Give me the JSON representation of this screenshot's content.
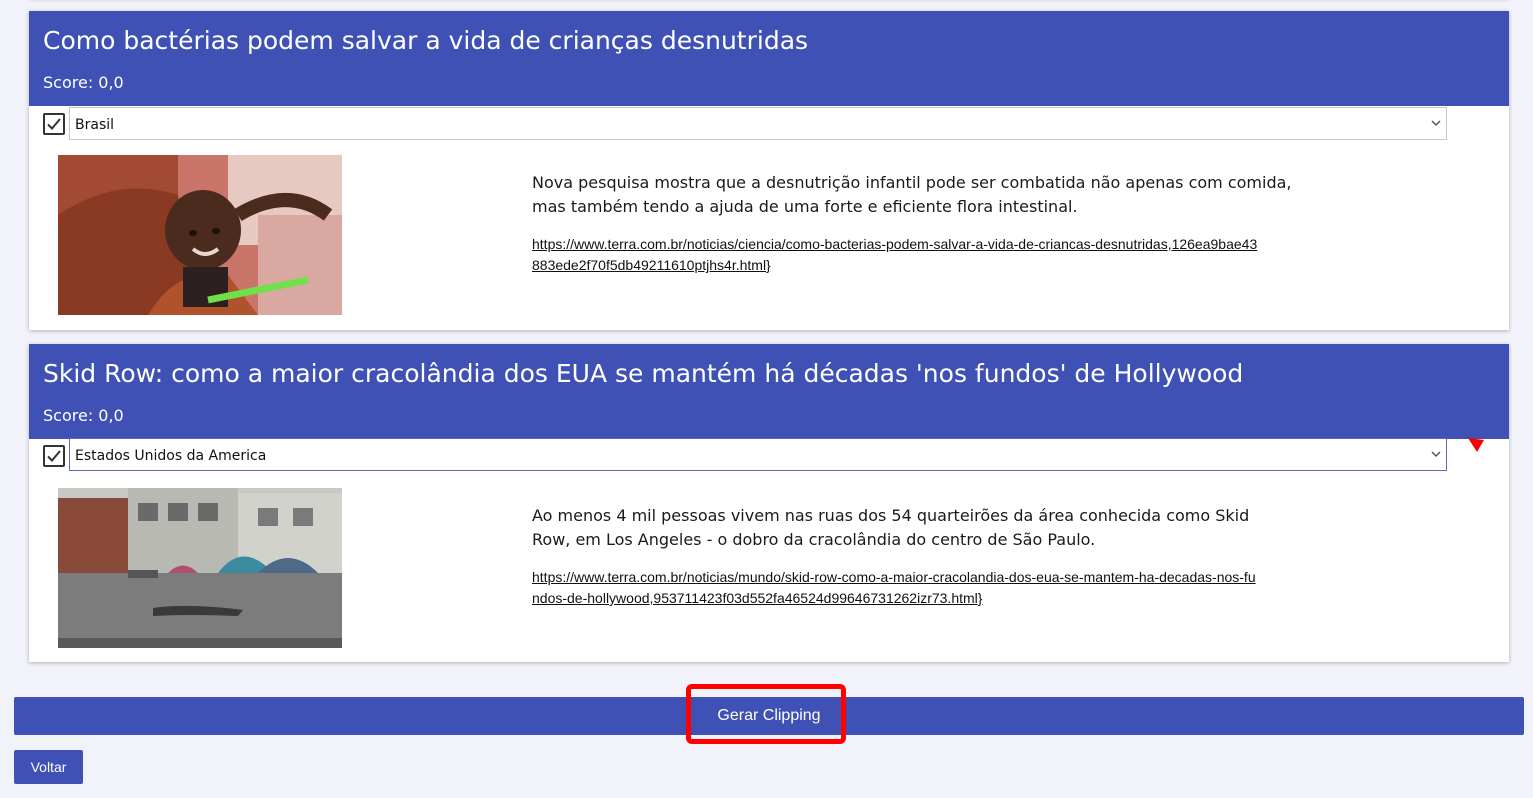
{
  "articles": [
    {
      "title": "Como bactérias podem salvar a vida de crianças desnutridas",
      "score": "Score: 0,0",
      "checked": true,
      "country": "Brasil",
      "image_icon": "malnourished-child-photo",
      "description": "Nova pesquisa mostra que a desnutrição infantil pode ser combatida não apenas com comida, mas também tendo a ajuda de uma forte e eficiente flora intestinal.",
      "link": "https://www.terra.com.br/noticias/ciencia/como-bacterias-podem-salvar-a-vida-de-criancas-desnutridas,126ea9bae43883ede2f70f5db49211610ptjhs4r.html}"
    },
    {
      "title": "Skid Row: como a maior cracolândia dos EUA se mantém há décadas 'nos fundos' de Hollywood",
      "score": "Score: 0,0",
      "checked": true,
      "country": "Estados Unidos da America",
      "image_icon": "skid-row-street-photo",
      "description": "Ao menos 4 mil pessoas vivem nas ruas dos 54 quarteirões da área conhecida como Skid Row, em Los Angeles - o dobro da cracolândia do centro de São Paulo.",
      "link": "https://www.terra.com.br/noticias/mundo/skid-row-como-a-maior-cracolandia-dos-eua-se-mantem-ha-decadas-nos-fundos-de-hollywood,953711423f03d552fa46524d99646731262izr73.html}"
    }
  ],
  "buttons": {
    "gerar_label": "Gerar Clipping",
    "voltar_label": "Voltar"
  },
  "colors": {
    "primary": "#3f51b5",
    "background": "#f2f2fb",
    "highlight": "#ff0000"
  }
}
